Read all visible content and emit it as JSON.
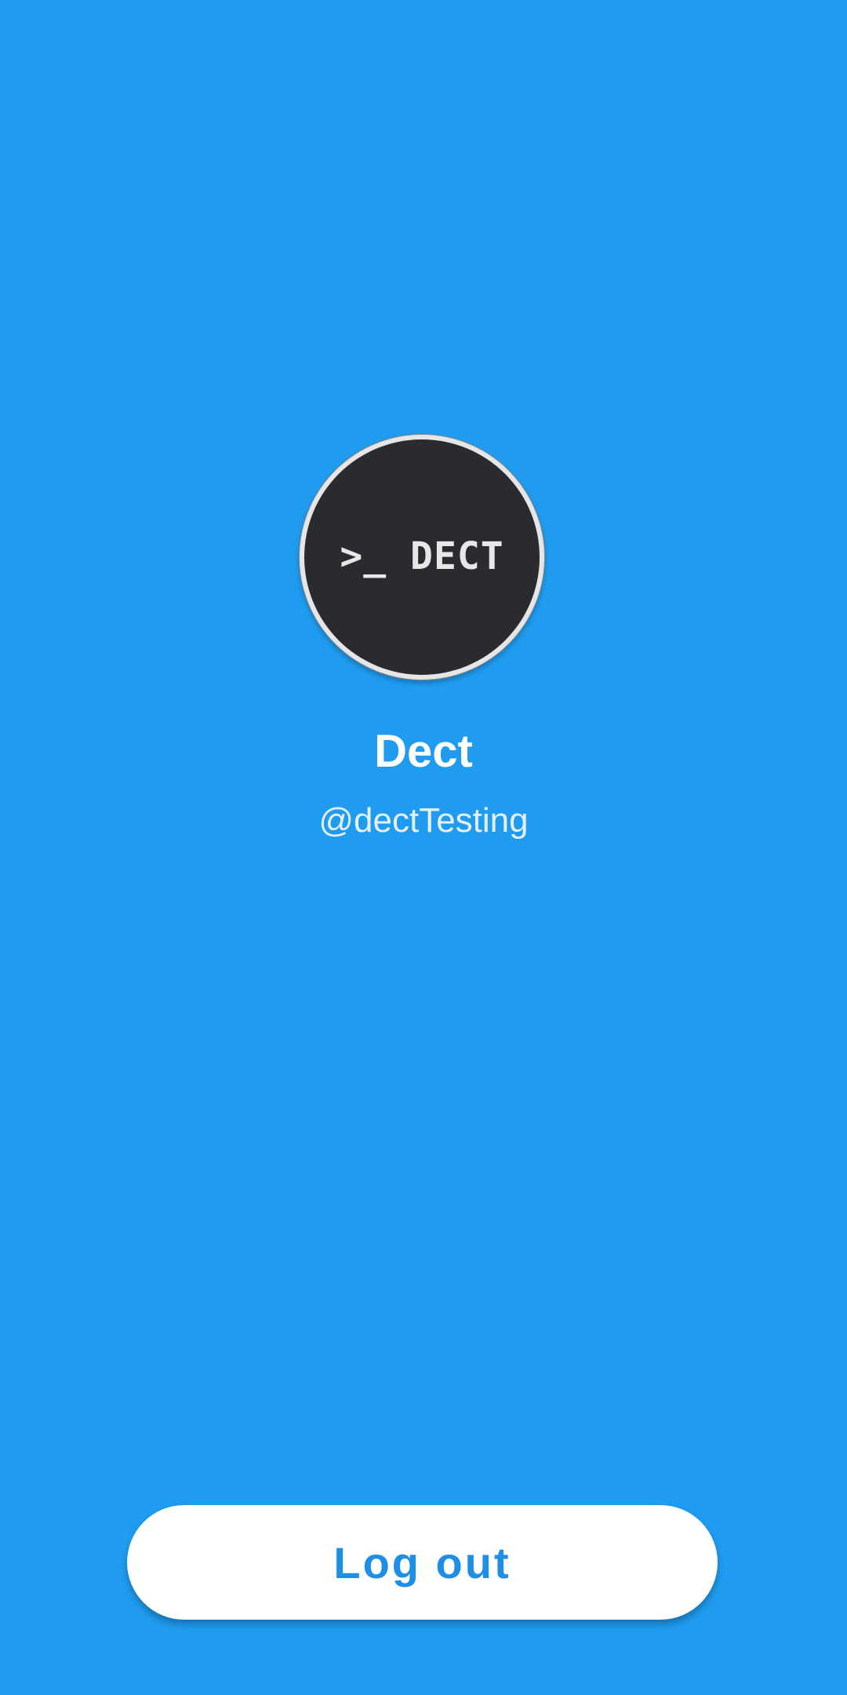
{
  "profile": {
    "avatar_text": ">_ DECT",
    "display_name": "Dect",
    "handle": "@dectTesting"
  },
  "actions": {
    "logout_label": "Log out"
  },
  "colors": {
    "background": "#1f9bef",
    "avatar_fill": "#2a2b2f",
    "avatar_ring": "#e6e6e6",
    "button_bg": "#ffffff",
    "button_text": "#1f8fe6"
  }
}
